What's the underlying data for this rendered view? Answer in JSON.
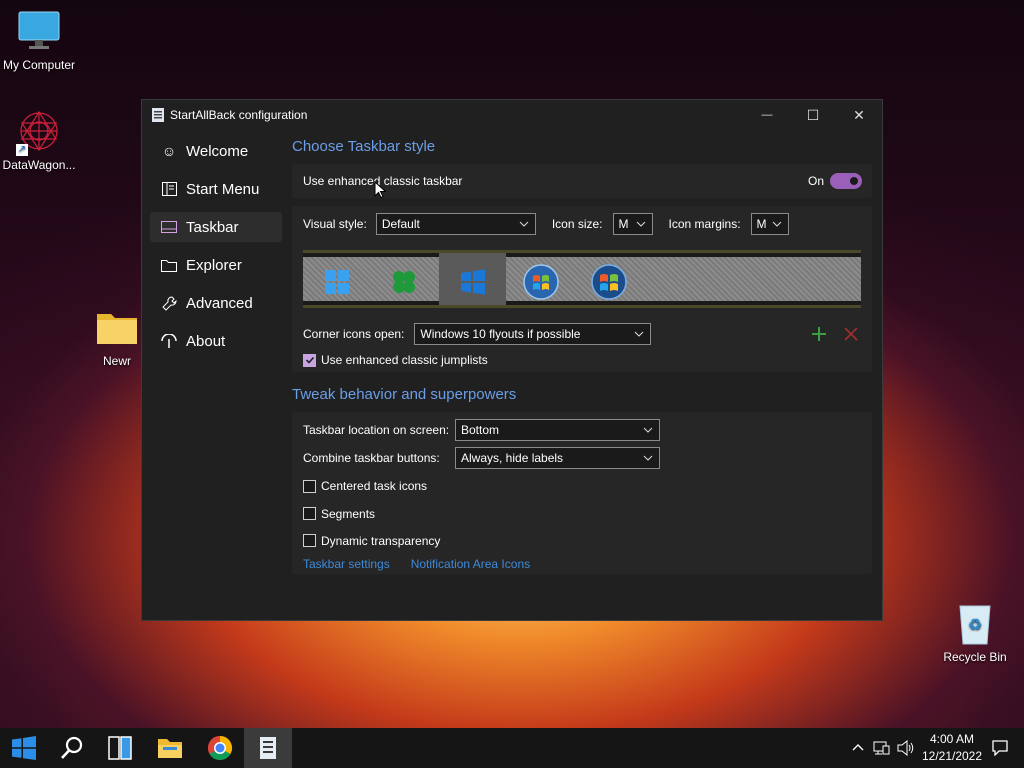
{
  "desktop": {
    "icons": [
      {
        "label": "My Computer"
      },
      {
        "label": "DataWagon..."
      },
      {
        "label": "Newr"
      },
      {
        "label": "Recycle Bin"
      }
    ]
  },
  "window": {
    "title": "StartAllBack configuration",
    "controls": {
      "minimize": "—",
      "maximize": "☐",
      "close": "✕"
    }
  },
  "sidebar": {
    "items": [
      {
        "label": "Welcome",
        "icon": "smile-icon"
      },
      {
        "label": "Start Menu",
        "icon": "start-menu-icon"
      },
      {
        "label": "Taskbar",
        "icon": "taskbar-icon",
        "active": true
      },
      {
        "label": "Explorer",
        "icon": "folder-icon"
      },
      {
        "label": "Advanced",
        "icon": "wrench-icon"
      },
      {
        "label": "About",
        "icon": "info-icon"
      }
    ]
  },
  "taskbar_style": {
    "section_title": "Choose Taskbar style",
    "enhanced_label": "Use enhanced classic taskbar",
    "toggle_state": "On",
    "visual_style_label": "Visual style:",
    "visual_style_value": "Default",
    "icon_size_label": "Icon size:",
    "icon_size_value": "M",
    "icon_margins_label": "Icon margins:",
    "icon_margins_value": "M",
    "style_previews": [
      "windows-11-logo-icon",
      "clover-logo-icon",
      "windows-10-logo-icon",
      "windows-7-orb-icon",
      "windows-vista-orb-icon"
    ],
    "selected_preview_index": 2,
    "corner_icons_label": "Corner icons open:",
    "corner_icons_value": "Windows 10 flyouts if possible",
    "add_icon": "plus-icon",
    "remove_icon": "x-icon",
    "jumplists_label": "Use enhanced classic jumplists",
    "jumplists_checked": true
  },
  "tweak": {
    "section_title": "Tweak behavior and superpowers",
    "location_label": "Taskbar location on screen:",
    "location_value": "Bottom",
    "combine_label": "Combine taskbar buttons:",
    "combine_value": "Always, hide labels",
    "centered_label": "Centered task icons",
    "segments_label": "Segments",
    "dynamic_label": "Dynamic transparency",
    "link_taskbar_settings": "Taskbar settings",
    "link_notification_icons": "Notification Area Icons"
  },
  "taskbar": {
    "time": "4:00 AM",
    "date": "12/21/2022"
  },
  "colors": {
    "accent_link": "#3f8ad8",
    "section_title": "#6a9ee8",
    "toggle_on": "#9a5fb8",
    "checkbox_on": "#c9a5e0"
  }
}
